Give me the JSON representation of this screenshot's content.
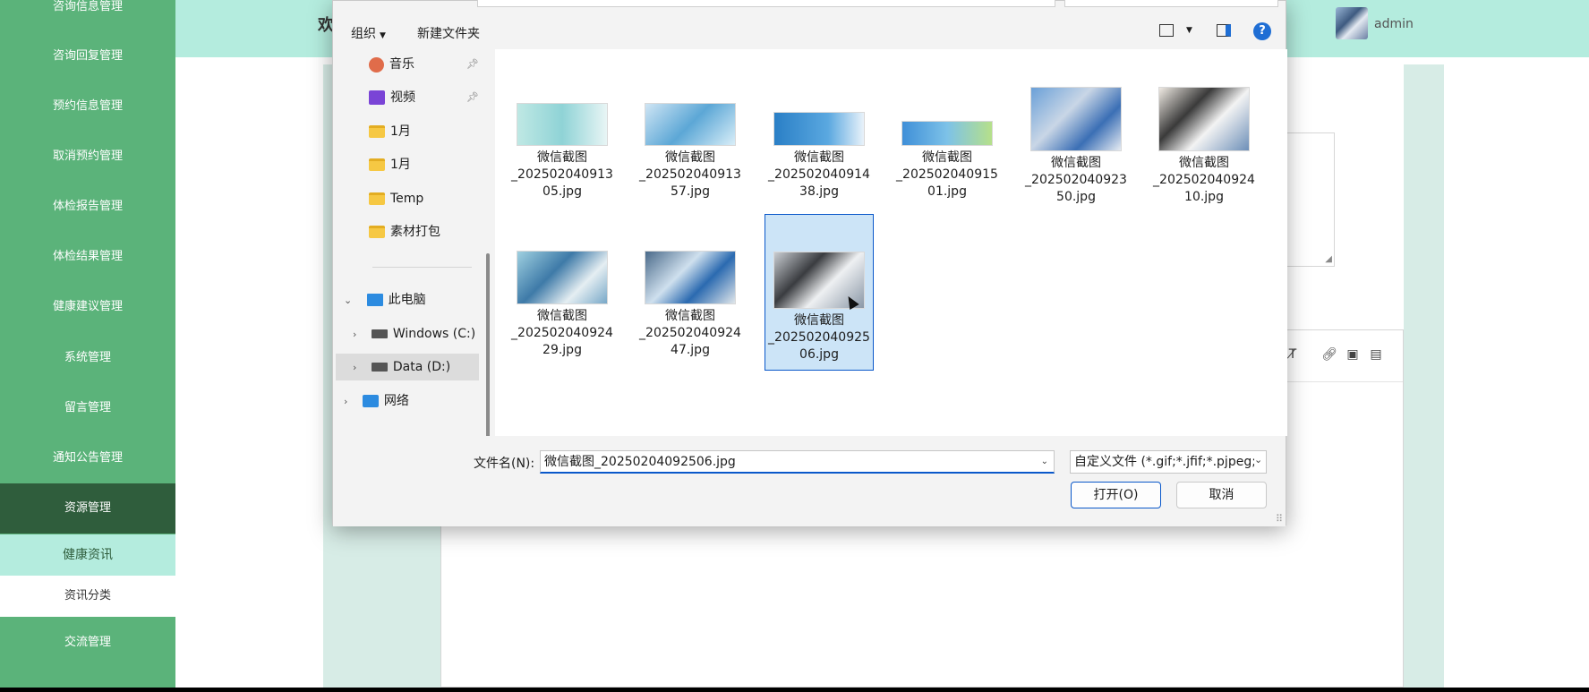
{
  "sidebar": {
    "items": [
      {
        "label": "咨询信息管理"
      },
      {
        "label": "咨询回复管理"
      },
      {
        "label": "预约信息管理"
      },
      {
        "label": "取消预约管理"
      },
      {
        "label": "体检报告管理"
      },
      {
        "label": "体检结果管理"
      },
      {
        "label": "健康建议管理"
      },
      {
        "label": "系统管理"
      },
      {
        "label": "留言管理"
      },
      {
        "label": "通知公告管理"
      },
      {
        "label": "资源管理"
      }
    ],
    "submenu_title": "健康资讯",
    "submenu_item": "资讯分类",
    "last_item": "交流管理"
  },
  "header": {
    "welcome": "欢",
    "username": "admin"
  },
  "dialog": {
    "organize": "组织",
    "new_folder": "新建文件夹",
    "help": "?",
    "nav": {
      "music": "音乐",
      "video": "视频",
      "folder1": "1月",
      "folder2": "1月",
      "temp": "Temp",
      "materials": "素材打包",
      "this_pc": "此电脑",
      "windows": "Windows (C:)",
      "data": "Data (D:)",
      "network": "网络"
    },
    "files": [
      {
        "label": "微信截图\n_202502040913\n05.jpg"
      },
      {
        "label": "微信截图\n_202502040913\n57.jpg"
      },
      {
        "label": "微信截图\n_202502040914\n38.jpg"
      },
      {
        "label": "微信截图\n_202502040915\n01.jpg"
      },
      {
        "label": "微信截图\n_202502040923\n50.jpg"
      },
      {
        "label": "微信截图\n_202502040924\n10.jpg"
      },
      {
        "label": "微信截图\n_202502040924\n29.jpg"
      },
      {
        "label": "微信截图\n_202502040924\n47.jpg"
      },
      {
        "label": "微信截图\n_202502040925\n06.jpg"
      }
    ],
    "filename_label": "文件名(N):",
    "filename_value": "微信截图_20250204092506.jpg",
    "filetype": "自定义文件 (*.gif;*.jfif;*.pjpeg;",
    "open": "打开(O)",
    "cancel": "取消"
  },
  "colors": {
    "sidebar": "#5bb37a",
    "sidebar_active": "#2f5d3c",
    "header": "#b4ecde",
    "accent": "#0a58ca"
  }
}
